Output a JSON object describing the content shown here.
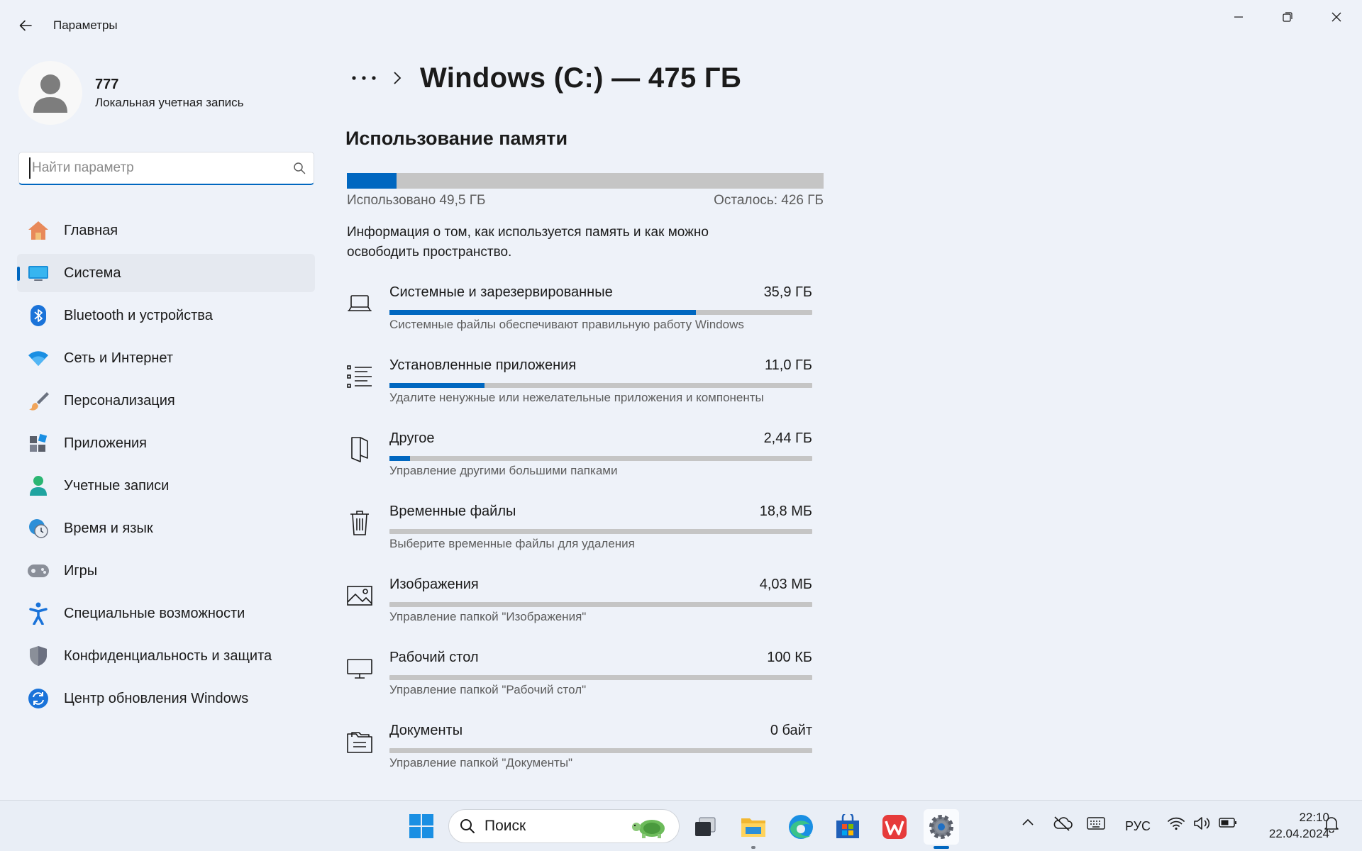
{
  "window": {
    "title": "Параметры",
    "controls": [
      "minimize-icon",
      "restore-icon",
      "close-icon"
    ]
  },
  "profile": {
    "name": "777",
    "account_type": "Локальная учетная запись"
  },
  "search": {
    "placeholder": "Найти параметр"
  },
  "sidebar": {
    "items": [
      {
        "label": "Главная",
        "icon": "home-icon"
      },
      {
        "label": "Система",
        "icon": "system-display-icon",
        "active": true
      },
      {
        "label": "Bluetooth и устройства",
        "icon": "bluetooth-icon"
      },
      {
        "label": "Сеть и Интернет",
        "icon": "wifi-icon"
      },
      {
        "label": "Персонализация",
        "icon": "brush-icon"
      },
      {
        "label": "Приложения",
        "icon": "apps-icon"
      },
      {
        "label": "Учетные записи",
        "icon": "user-icon"
      },
      {
        "label": "Время и язык",
        "icon": "globe-clock-icon"
      },
      {
        "label": "Игры",
        "icon": "gamepad-icon"
      },
      {
        "label": "Специальные возможности",
        "icon": "accessibility-icon"
      },
      {
        "label": "Конфиденциальность и защита",
        "icon": "shield-icon"
      },
      {
        "label": "Центр обновления Windows",
        "icon": "update-icon"
      }
    ]
  },
  "main": {
    "page_title": "Windows (C:) — 475 ГБ",
    "section_title": "Использование памяти",
    "usage": {
      "used_label": "Использовано 49,5 ГБ",
      "free_label": "Осталось: 426 ГБ",
      "used_fraction": 0.104,
      "info": "Информация о том, как используется память и как можно освободить пространство."
    },
    "categories": [
      {
        "name": "Системные и зарезервированные",
        "size": "35,9 ГБ",
        "description": "Системные файлы обеспечивают правильную работу Windows",
        "fraction": 0.725,
        "icon": "laptop-icon"
      },
      {
        "name": "Установленные приложения",
        "size": "11,0 ГБ",
        "description": "Удалите ненужные или нежелательные приложения и компоненты",
        "fraction": 0.225,
        "icon": "list-icon"
      },
      {
        "name": "Другое",
        "size": "2,44 ГБ",
        "description": "Управление другими большими папками",
        "fraction": 0.049,
        "icon": "folder-outline-icon"
      },
      {
        "name": "Временные файлы",
        "size": "18,8 МБ",
        "description": "Выберите временные файлы для удаления",
        "fraction": 0.0,
        "icon": "trash-icon"
      },
      {
        "name": "Изображения",
        "size": "4,03 МБ",
        "description": "Управление папкой \"Изображения\"",
        "fraction": 0.0,
        "icon": "image-icon"
      },
      {
        "name": "Рабочий стол",
        "size": "100 КБ",
        "description": "Управление папкой \"Рабочий стол\"",
        "fraction": 0.0,
        "icon": "monitor-icon"
      },
      {
        "name": "Документы",
        "size": "0 байт",
        "description": "Управление папкой \"Документы\"",
        "fraction": 0.0,
        "icon": "documents-icon"
      }
    ]
  },
  "taskbar": {
    "search_label": "Поиск",
    "apps": [
      "start-icon",
      "task-view-icon",
      "file-explorer-icon",
      "edge-icon",
      "store-icon",
      "wps-office-icon",
      "settings-icon"
    ],
    "language": "РУС",
    "time": "22:10",
    "date": "22.04.2024"
  },
  "colors": {
    "accent": "#0067c0",
    "bar_track": "#c5c5c5",
    "background": "#eef2f9"
  }
}
